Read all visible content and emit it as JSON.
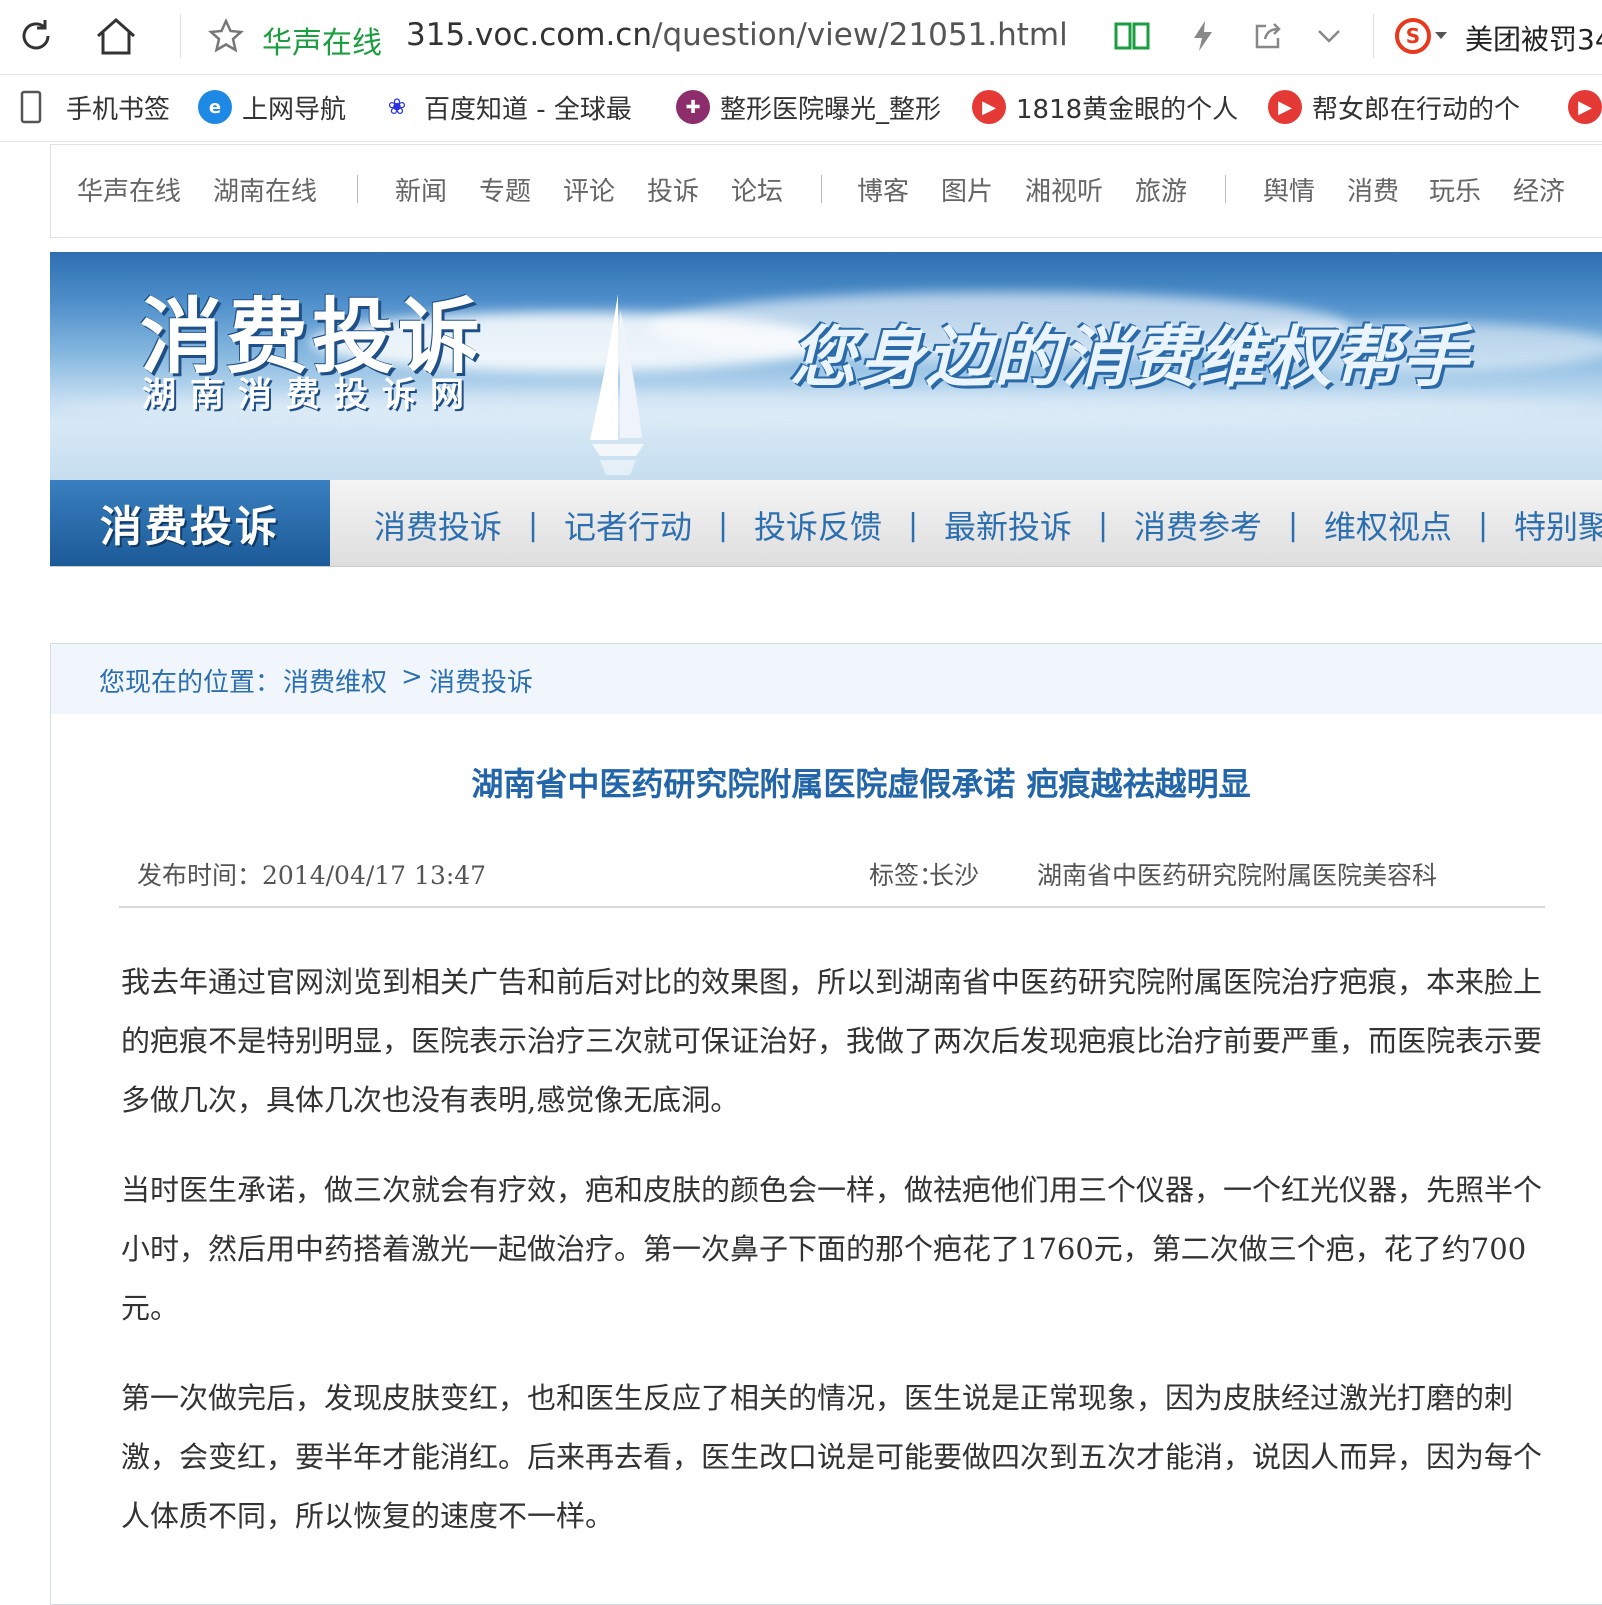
{
  "browser": {
    "site_name": "华声在线",
    "url_host": "315.voc.com.cn",
    "url_path": "/question/view/21051.html",
    "search_text": "美团被罚34",
    "accent": "#1a9e3f"
  },
  "bookmarks": [
    {
      "label": "手机书签",
      "icon": "phone-icon"
    },
    {
      "label": "上网导航",
      "icon": "ie-icon"
    },
    {
      "label": "百度知道 - 全球最",
      "icon": "baidu-icon"
    },
    {
      "label": "整形医院曝光_整形",
      "icon": "hospital-icon"
    },
    {
      "label": "1818黄金眼的个人",
      "icon": "play-icon"
    },
    {
      "label": "帮女郎在行动的个",
      "icon": "play-icon"
    }
  ],
  "site_nav": [
    "华声在线",
    "湖南在线",
    "新闻",
    "专题",
    "评论",
    "投诉",
    "论坛",
    "博客",
    "图片",
    "湘视听",
    "旅游",
    "舆情",
    "消费",
    "玩乐",
    "经济"
  ],
  "banner": {
    "title": "消费投诉",
    "subtitle": "湖南消费投诉网",
    "slogan": "您身边的消费维权帮手"
  },
  "section_nav": {
    "label": "消费投诉",
    "items": [
      "消费投诉",
      "记者行动",
      "投诉反馈",
      "最新投诉",
      "消费参考",
      "维权视点",
      "特别聚"
    ]
  },
  "breadcrumb": {
    "prefix": "您现在的位置：",
    "level1": "消费维权",
    "separator": ">",
    "level2": "消费投诉"
  },
  "article": {
    "title": "湖南省中医药研究院附属医院虚假承诺 疤痕越祛越明显",
    "published": "发布时间：2014/04/17 13:47",
    "tags_label": "标签：",
    "tag1": "长沙",
    "tag2": "湖南省中医药研究院附属医院美容科",
    "paragraphs": [
      "我去年通过官网浏览到相关广告和前后对比的效果图，所以到湖南省中医药研究院附属医院治疗疤痕，本来脸上的疤痕不是特别明显，医院表示治疗三次就可保证治好，我做了两次后发现疤痕比治疗前要严重，而医院表示要多做几次，具体几次也没有表明,感觉像无底洞。",
      "当时医生承诺，做三次就会有疗效，疤和皮肤的颜色会一样，做祛疤他们用三个仪器，一个红光仪器，先照半个小时，然后用中药搭着激光一起做治疗。第一次鼻子下面的那个疤花了1760元，第二次做三个疤，花了约700元。",
      "第一次做完后，发现皮肤变红，也和医生反应了相关的情况，医生说是正常现象，因为皮肤经过激光打磨的刺激，会变红，要半年才能消红。后来再去看，医生改口说是可能要做四次到五次才能消，说因人而异，因为每个人体质不同，所以恢复的速度不一样。"
    ]
  }
}
